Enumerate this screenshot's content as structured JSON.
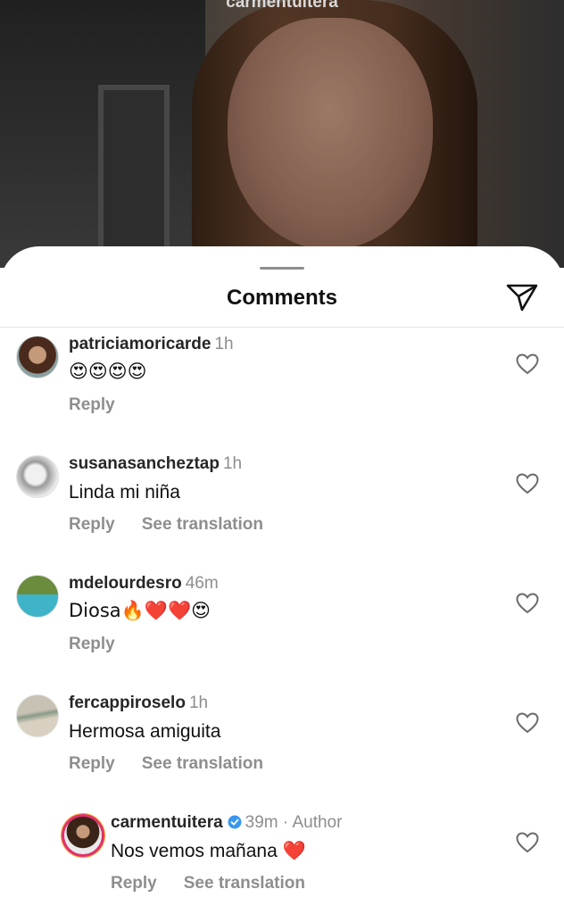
{
  "post": {
    "username": "carmentuitera"
  },
  "sheet": {
    "title": "Comments",
    "share_icon": "send-icon"
  },
  "comments": [
    {
      "username": "patriciamoricarde",
      "time": "1h",
      "text": "😍😍😍😍",
      "reply": "Reply"
    },
    {
      "username": "susanasancheztap",
      "time": "1h",
      "text": "Linda mi niña",
      "reply": "Reply",
      "translation": "See translation"
    },
    {
      "username": "mdelourdesro",
      "time": "46m",
      "text": "Diosa🔥❤️❤️😍",
      "reply": "Reply"
    },
    {
      "username": "fercappiroselo",
      "time": "1h",
      "text": "Hermosa amiguita",
      "reply": "Reply",
      "translation": "See translation"
    },
    {
      "username": "carmentuitera",
      "time": "39m · Author",
      "text": "Nos vemos mañana ❤️",
      "reply": "Reply",
      "translation": "See translation",
      "verified": true
    }
  ],
  "colors": {
    "accent_verified": "#3897f0",
    "muted": "#8e8e8e",
    "text": "#262626"
  }
}
